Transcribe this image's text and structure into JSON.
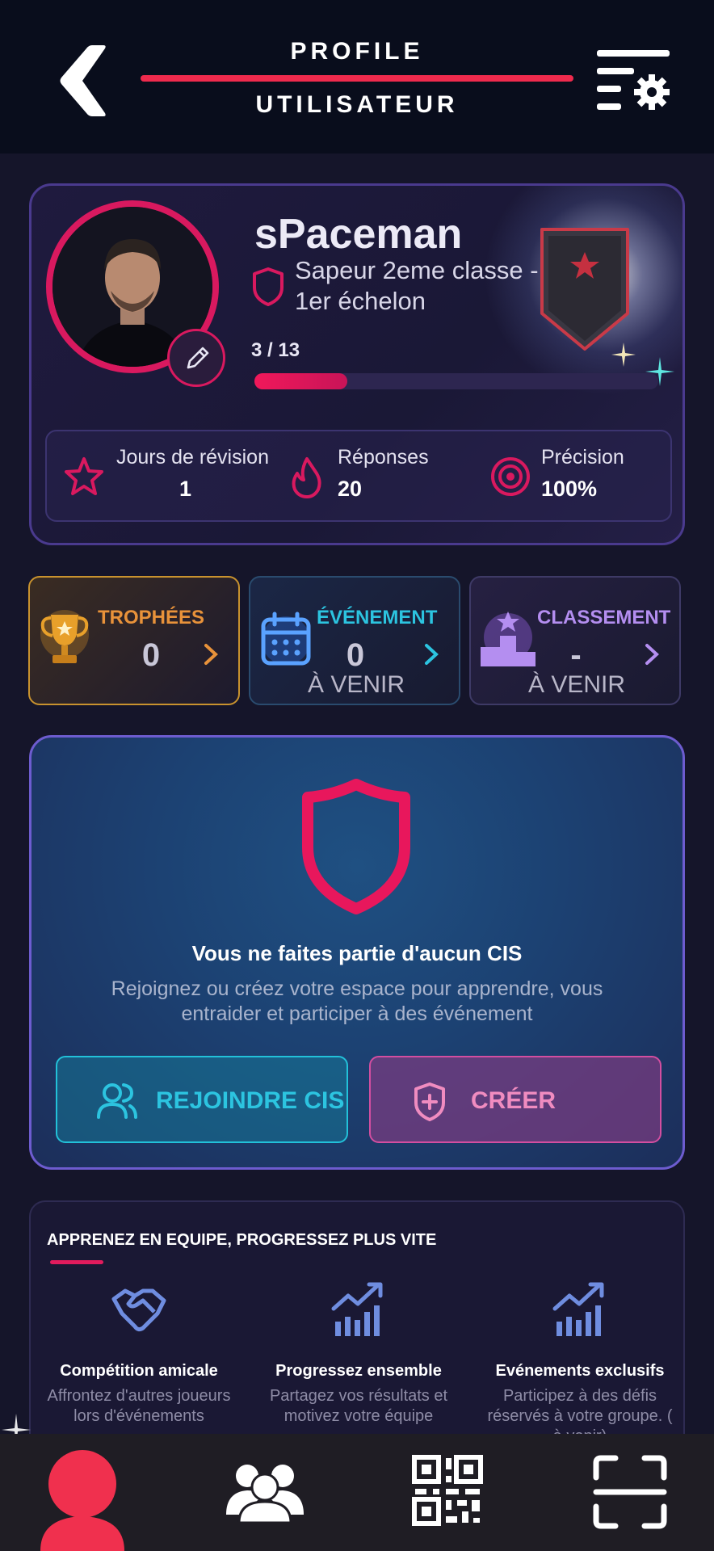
{
  "header": {
    "title_line1": "PROFILE",
    "title_line2": "UTILISATEUR",
    "accent": "#ef2a4d"
  },
  "profile": {
    "username": "sPaceman",
    "rank": "Sapeur 2eme classe - 1er échelon",
    "progress_text": "3 / 13",
    "progress_current": 3,
    "progress_total": 13
  },
  "stats": [
    {
      "label": "Jours de révision",
      "value": "1",
      "icon": "star-icon"
    },
    {
      "label": "Réponses",
      "value": "20",
      "icon": "flame-icon"
    },
    {
      "label": "Précision",
      "value": "100%",
      "icon": "target-icon"
    }
  ],
  "tiles": {
    "trophies": {
      "title": "TROPHÉES",
      "value": "0",
      "color": "#e8923a"
    },
    "events": {
      "title": "ÉVÉNEMENT",
      "value": "0",
      "sub": "À VENIR",
      "color": "#2cc4e0"
    },
    "ranking": {
      "title": "CLASSEMENT",
      "value": "-",
      "sub": "À VENIR",
      "color": "#b48ef0"
    }
  },
  "cis": {
    "title": "Vous ne faites partie d'aucun CIS",
    "description": "Rejoignez ou créez votre espace pour apprendre, vous entraider et participer à des événement",
    "join_label": "REJOINDRE CIS",
    "create_label": "CRÉER"
  },
  "team": {
    "title": "APPRENEZ EN EQUIPE, PROGRESSEZ PLUS VITE",
    "features": [
      {
        "title": "Compétition amicale",
        "desc": "Affrontez d'autres joueurs lors d'événements",
        "icon": "handshake-icon"
      },
      {
        "title": "Progressez ensemble",
        "desc": "Partagez vos résultats et motivez votre équipe",
        "icon": "growth-chart-icon"
      },
      {
        "title": "Evénements exclusifs",
        "desc": "Participez à des défis réservés à votre groupe. ( à venir)",
        "icon": "growth-chart-icon"
      }
    ]
  },
  "nav": {
    "items": [
      "profile-icon",
      "group-icon",
      "qr-code-icon",
      "scan-icon"
    ],
    "active_color": "#f0304e"
  }
}
